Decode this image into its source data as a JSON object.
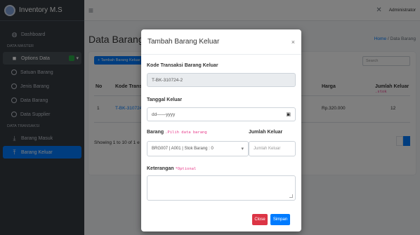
{
  "sidebar": {
    "brand": "Inventory M.S",
    "dashboard": "Dashboard",
    "header_master": "DATA MASTER",
    "options": "Options Data",
    "items_master": [
      "Satuan Barang",
      "Jenis Barang",
      "Data Barang",
      "Data Supplier"
    ],
    "header_trans": "DATA TRANSAKSI",
    "barang_masuk": "Barang Masuk",
    "barang_keluar": "Barang Keluar"
  },
  "topbar": {
    "menu_icon": "≡",
    "x_icon": "✕",
    "user": "Administrator"
  },
  "page": {
    "title": "Data Barang K",
    "breadcrumb_home": "Home",
    "breadcrumb_sep": " / ",
    "breadcrumb_current": "Data Barang",
    "add_button": "+ Tambah Barang Keluar",
    "search_placeholder": "Search",
    "columns": {
      "no": "No",
      "kode": "Kode Trans",
      "harga": "Harga",
      "jumlah": "Jumlah Keluar"
    },
    "jumlah_hint": ".stok",
    "row": {
      "no": "1",
      "kode": "T-BK-310724",
      "harga": "Rp.320.000",
      "jumlah": "12"
    },
    "showing": "Showing 1 to 10 of 1 e"
  },
  "modal": {
    "title": "Tambah Barang Keluar",
    "close_icon": "×",
    "kode_label": "Kode Transaksi Barang Keluar",
    "kode_value": "T-BK-310724-2",
    "tanggal_label": "Tanggal Keluar",
    "tanggal_value": "dd——yyyy",
    "calendar_icon": "▣",
    "barang_label": "Barang",
    "barang_hint": ".Pilih data barang",
    "barang_value": "BRG007 | A001 | Stok Barang : 0",
    "select_arrow": "▾",
    "jumlah_label": "Jumlah Keluar",
    "jumlah_placeholder": "Jumlah Keluar",
    "keterangan_label": "Keterangan",
    "keterangan_hint": "*Optional",
    "close_button": "Close",
    "save_button": "Simpan"
  },
  "colors": {
    "primary": "#007bff",
    "danger": "#dc3545",
    "sidebar": "#343a40",
    "hint": "#e83e8c"
  }
}
